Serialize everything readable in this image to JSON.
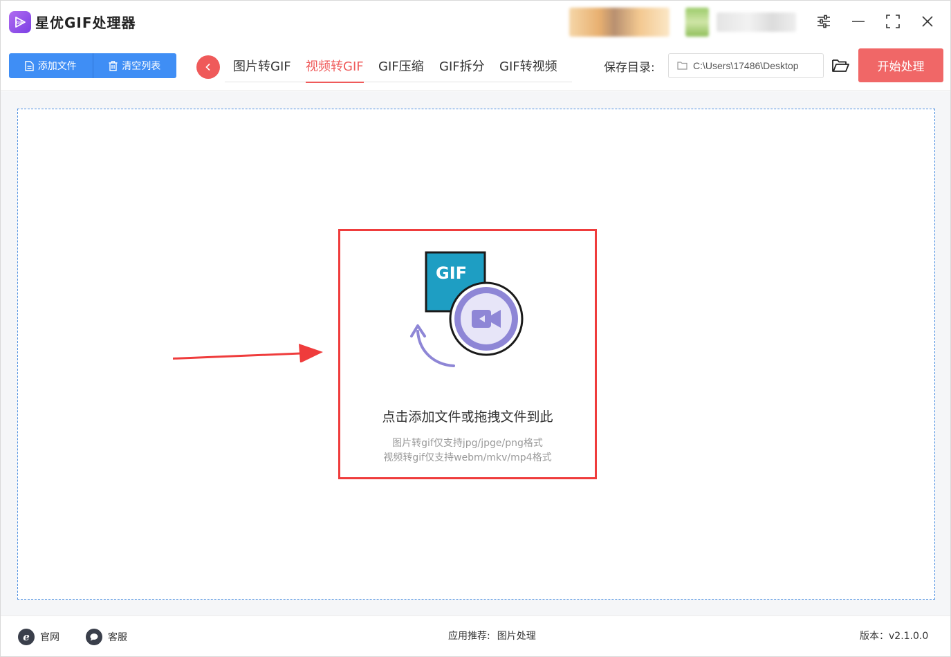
{
  "app": {
    "title": "星优GIF处理器",
    "logo_text": "GIF"
  },
  "window_controls": [
    "settings-icon",
    "minimize-icon",
    "maximize-icon",
    "close-icon"
  ],
  "toolbar": {
    "add_file": "添加文件",
    "clear_list": "清空列表",
    "tabs": [
      {
        "label": "图片转GIF",
        "active": false
      },
      {
        "label": "视频转GIF",
        "active": true
      },
      {
        "label": "GIF压缩",
        "active": false
      },
      {
        "label": "GIF拆分",
        "active": false
      },
      {
        "label": "GIF转视频",
        "active": false
      }
    ],
    "save_dir_label": "保存目录:",
    "save_dir_value": "C:\\Users\\17486\\Desktop",
    "start_button": "开始处理"
  },
  "drop_zone": {
    "illustration_label": "GIF",
    "prompt": "点击添加文件或拖拽文件到此",
    "hint_image": "图片转gif仅支持jpg/jpge/png格式",
    "hint_video": "视频转gif仅支持webm/mkv/mp4格式"
  },
  "footer": {
    "website": "官网",
    "support": "客服",
    "recommend_label": "应用推荐:",
    "recommend_app": "图片处理",
    "version": "版本：v2.1.0.0"
  },
  "colors": {
    "accent": "#ef5a5a",
    "primary": "#3f8ef5",
    "highlight_border": "#ef3c3c"
  }
}
